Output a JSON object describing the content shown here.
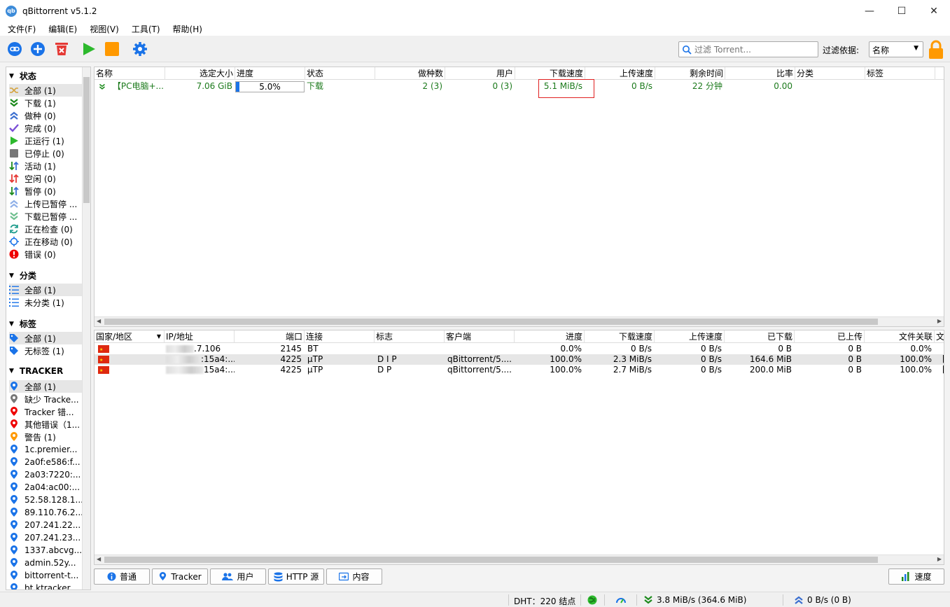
{
  "window": {
    "title": "qBittorrent v5.1.2",
    "minimize": "—",
    "maximize": "☐",
    "close": "✕",
    "app_icon_text": "qb"
  },
  "menu": [
    "文件(F)",
    "编辑(E)",
    "视图(V)",
    "工具(T)",
    "帮助(H)"
  ],
  "toolbar": {
    "search_placeholder": "过滤 Torrent...",
    "filter_label": "过滤依据:",
    "filter_value": "名称"
  },
  "sidebar": {
    "status_header": "状态",
    "status_items": [
      "全部 (1)",
      "下载 (1)",
      "做种 (0)",
      "完成 (0)",
      "正运行 (1)",
      "已停止 (0)",
      "活动 (1)",
      "空闲 (0)",
      "暂停 (0)",
      "上传已暂停 ...",
      "下载已暂停 ...",
      "正在检查 (0)",
      "正在移动 (0)",
      "错误 (0)"
    ],
    "category_header": "分类",
    "category_items": [
      "全部 (1)",
      "未分类 (1)"
    ],
    "tag_header": "标签",
    "tag_items": [
      "全部 (1)",
      "无标签 (1)"
    ],
    "tracker_header": "TRACKER",
    "tracker_items": [
      "全部 (1)",
      "缺少 Tracke...",
      "Tracker 错...",
      "其他错误（1...",
      "警告 (1)",
      "1c.premier...",
      "2a0f:e586:f...",
      "2a03:7220:...",
      "2a04:ac00:...",
      "52.58.128.1...",
      "89.110.76.2...",
      "207.241.22...",
      "207.241.23...",
      "1337.abcvg...",
      "admin.52y...",
      "bittorrent-t...",
      "bt.ktracker..."
    ]
  },
  "torrents": {
    "columns": [
      "名称",
      "选定大小",
      "进度",
      "状态",
      "做种数",
      "用户",
      "下载速度",
      "上传速度",
      "剩余时间",
      "比率",
      "分类",
      "标签"
    ],
    "rows": [
      {
        "name": "【PC电脑+...",
        "size": "7.06 GiB",
        "progress": 0.05,
        "progress_text": "5.0%",
        "status": "下载",
        "seeds": "2 (3)",
        "peers": "0 (3)",
        "dl_speed": "5.1 MiB/s",
        "up_speed": "0 B/s",
        "eta": "22 分钟",
        "ratio": "0.00",
        "category": "",
        "tags": ""
      }
    ]
  },
  "peers": {
    "columns": [
      "国家/地区",
      "IP/地址",
      "端口",
      "连接",
      "标志",
      "客户端",
      "进度",
      "下载速度",
      "上传速度",
      "已下载",
      "已上传",
      "文件关联",
      "文"
    ],
    "rows": [
      {
        "ip": ".7.106",
        "port": "2145",
        "conn": "BT",
        "flags": "",
        "client": "",
        "progress": "0.0%",
        "dl": "0 B/s",
        "up": "0 B/s",
        "downloaded": "0 B",
        "uploaded": "0 B",
        "relevance": "0.0%",
        "extra": ""
      },
      {
        "ip": ":15a4:...",
        "port": "4225",
        "conn": "µTP",
        "flags": "D I P",
        "client": "qBittorrent/5....",
        "progress": "100.0%",
        "dl": "2.3 MiB/s",
        "up": "0 B/s",
        "downloaded": "164.6 MiB",
        "uploaded": "0 B",
        "relevance": "100.0%",
        "extra": "【"
      },
      {
        "ip": "15a4:...",
        "port": "4225",
        "conn": "µTP",
        "flags": "D P",
        "client": "qBittorrent/5....",
        "progress": "100.0%",
        "dl": "2.7 MiB/s",
        "up": "0 B/s",
        "downloaded": "200.0 MiB",
        "uploaded": "0 B",
        "relevance": "100.0%",
        "extra": "【"
      }
    ]
  },
  "tabs": [
    "普通",
    "Tracker",
    "用户",
    "HTTP 源",
    "内容"
  ],
  "speed_button": "速度",
  "statusbar": {
    "dht": "DHT：220 结点",
    "download": "3.8 MiB/s (364.6 MiB)",
    "upload": "0 B/s (0 B)"
  },
  "colors": {
    "accent": "#1a73e8",
    "green_text": "#1c7a1c",
    "highlight_box": "#e02020",
    "play": "#2db92d",
    "stop": "#ff9900"
  }
}
